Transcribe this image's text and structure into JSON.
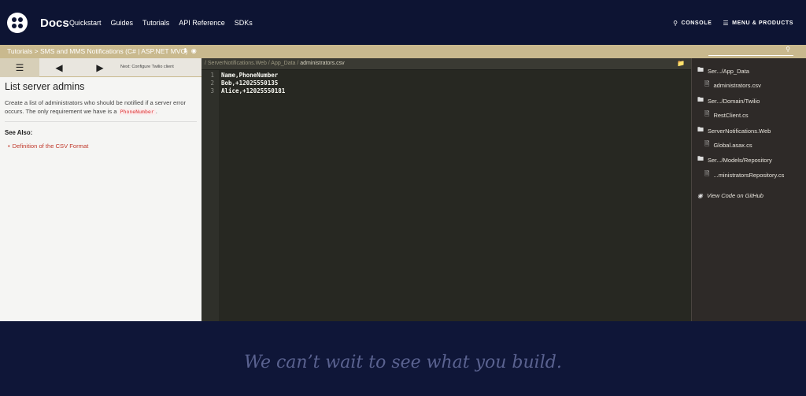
{
  "topnav": {
    "brand": "Docs",
    "links": [
      "Quickstart",
      "Guides",
      "Tutorials",
      "API Reference",
      "SDKs"
    ],
    "console_label": "CONSOLE",
    "menu_label": "MENU & PRODUCTS"
  },
  "breadcrumb": {
    "text": "Tutorials > SMS and MMS Notifications (C# | ASP.NET MVC)"
  },
  "left": {
    "next_label": "Next: Configure Twilio client",
    "title": "List server admins",
    "desc_before": "Create a list of administrators who should be notified if a server error occurs. The only requirement we have is a ",
    "desc_code": "PhoneNumber",
    "desc_after": ".",
    "see_also": "See Also:",
    "link": "Definition of the CSV Format"
  },
  "editor": {
    "path_prefix": "/ ServerNotifications.Web / App_Data / ",
    "path_current": "administrators.csv",
    "lines": [
      {
        "num": "1",
        "text": "Name,PhoneNumber"
      },
      {
        "num": "2",
        "text": "Bob,+12025550135"
      },
      {
        "num": "3",
        "text": "Alice,+12025550181"
      }
    ]
  },
  "tree": {
    "items": [
      {
        "kind": "folder",
        "label": "Ser.../App_Data"
      },
      {
        "kind": "file",
        "label": "administrators.csv"
      },
      {
        "kind": "folder",
        "label": "Ser.../Domain/Twilio"
      },
      {
        "kind": "file",
        "label": "RestClient.cs"
      },
      {
        "kind": "folder",
        "label": "ServerNotifications.Web"
      },
      {
        "kind": "file",
        "label": "Global.asax.cs"
      },
      {
        "kind": "folder",
        "label": "Ser.../Models/Repository"
      },
      {
        "kind": "file",
        "label": "...ministratorsRepository.cs"
      }
    ],
    "github": "View Code on GitHub"
  },
  "footer": {
    "tagline": "We can’t wait to see what you build."
  }
}
